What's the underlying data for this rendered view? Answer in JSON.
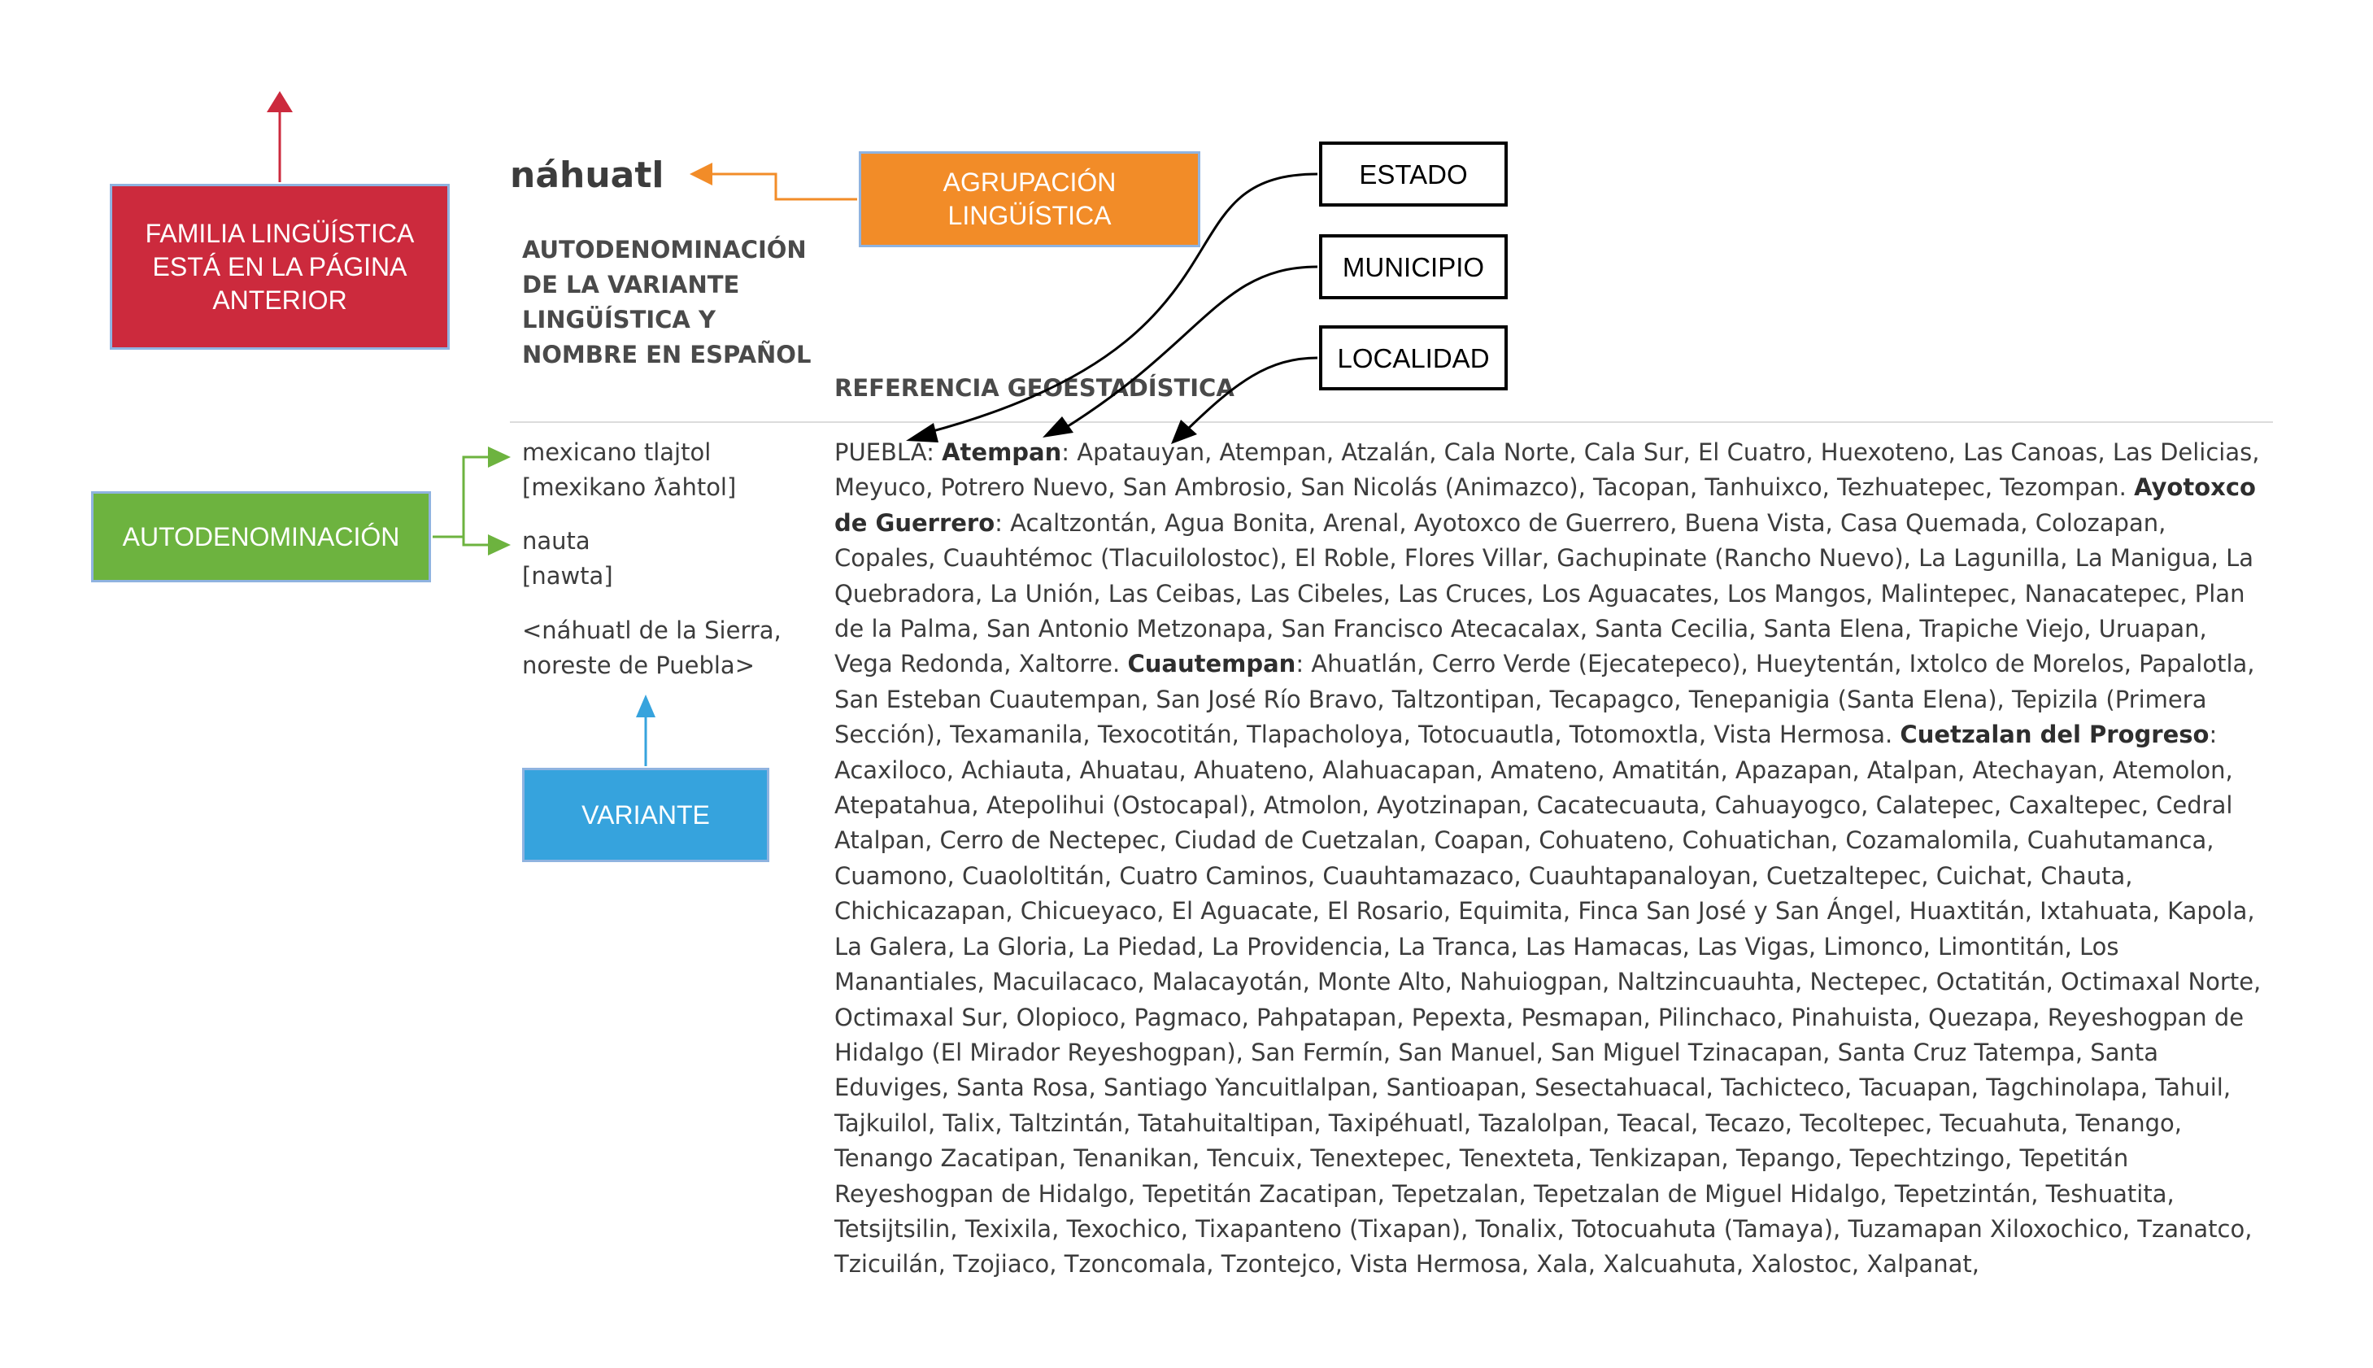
{
  "title": "náhuatl",
  "headers": {
    "left": "AUTODENOMINACIÓN DE LA VARIANTE LINGÜÍSTICA Y NOMBRE EN ESPAÑOL",
    "right": "REFERENCIA GEOESTADÍSTICA"
  },
  "variants": [
    {
      "name": "mexicano tlajtol",
      "ipa": "[mexikano ƛahtol]"
    },
    {
      "name": "nauta",
      "ipa": "[nawta]"
    }
  ],
  "spanish_name": "<náhuatl de la Sierra, noreste de Puebla>",
  "geo": [
    {
      "state": "PUEBLA",
      "municipality": "Atempan",
      "localities": "Apatauyan, Atempan, Atzalán, Cala Norte, Cala Sur, El Cuatro, Huexoteno, Las Canoas, Las Delicias, Meyuco, Potrero Nuevo, San Ambrosio, San Nicolás (Animazco), Tacopan, Tanhuixco, Tezhuatepec, Tezompan."
    },
    {
      "municipality": "Ayotoxco de Guerrero",
      "localities": "Acaltzontán, Agua Bonita, Arenal, Ayotoxco de Guerrero, Buena Vista, Casa Quemada, Colozapan, Copales, Cuauhtémoc (Tlacuilolostoc), El Roble, Flores Villar, Gachupinate (Rancho Nuevo), La Lagunilla, La Manigua, La Quebradora, La Unión, Las Ceibas, Las Cibeles, Las Cruces, Los Aguacates, Los Mangos, Malintepec, Nanacatepec, Plan de la Palma, San Antonio Metzonapa, San Francisco Atecacalax, Santa Cecilia, Santa Elena, Trapiche Viejo, Uruapan, Vega Redonda, Xaltorre."
    },
    {
      "municipality": "Cuautempan",
      "localities": "Ahuatlán, Cerro Verde (Ejecatepeco), Hueytentán, Ixtolco de Morelos, Papalotla, San Esteban Cuautempan, San José Río Bravo, Taltzontipan, Tecapagco, Tenepanigia (Santa Elena), Tepizila (Primera Sección), Texamanila, Texocotitán, Tlapacholoya, Totocuautla, Totomoxtla, Vista Hermosa."
    },
    {
      "municipality": "Cuetzalan del Progreso",
      "localities": "Acaxiloco, Achiauta, Ahuatau, Ahuateno, Alahuacapan, Amateno, Amatitán, Apazapan, Atalpan, Atechayan, Atemolon, Atepatahua, Atepolihui (Ostocapal), Atmolon, Ayotzinapan, Cacatecuauta, Cahuayogco, Calatepec, Caxaltepec, Cedral Atalpan, Cerro de Nectepec, Ciudad de Cuetzalan, Coapan, Cohuateno, Cohuatichan, Cozamalomila, Cuahutamanca, Cuamono, Cuaololtitán, Cuatro Caminos, Cuauhtamazaco, Cuauhtapanaloyan, Cuetzaltepec, Cuichat, Chauta, Chichicazapan, Chicueyaco, El Aguacate, El Rosario, Equimita, Finca San José y San Ángel, Huaxtitán, Ixtahuata, Kapola, La Galera, La Gloria, La Piedad, La Providencia, La Tranca, Las Hamacas, Las Vigas, Limonco, Limontitán, Los Manantiales, Macuilacaco, Malacayotán, Monte Alto, Nahuiogpan, Naltzincuauhta, Nectepec, Octatitán, Octimaxal Norte, Octimaxal Sur, Olopioco, Pagmaco, Pahpatapan, Pepexta, Pesmapan, Pilinchaco, Pinahuista, Quezapa, Reyeshogpan de Hidalgo (El Mirador Reyeshogpan), San Fermín, San Manuel, San Miguel Tzinacapan, Santa Cruz Tatempa, Santa Eduviges, Santa Rosa, Santiago Yancuitlalpan, Santioapan, Sesectahuacal, Tachicteco, Tacuapan, Tagchinolapa, Tahuil, Tajkuilol, Talix, Taltzintán, Tatahuitaltipan, Taxipéhuatl, Tazalolpan, Teacal, Tecazo, Tecoltepec, Tecuahuta, Tenango, Tenango Zacatipan, Tenanikan, Tencuix, Tenextepec, Tenexteta, Tenkizapan, Tepango, Tepechtzingo, Tepetitán Reyeshogpan de Hidalgo, Tepetitán Zacatipan, Tepetzalan, Tepetzalan de Miguel Hidalgo, Tepetzintán, Teshuatita, Tetsijtsilin, Texixila, Texochico, Tixapanteno (Tixapan), Tonalix, Totocuahuta (Tamaya), Tuzamapan Xiloxochico, Tzanatco, Tzicuilán, Tzojiaco, Tzoncomala, Tzontejco, Vista Hermosa, Xala, Xalcuahuta, Xalostoc, Xalpanat,"
    }
  ],
  "annotations": {
    "familia": "FAMILIA LINGÜÍSTICA ESTÁ EN LA PÁGINA ANTERIOR",
    "agrupacion": "AGRUPACIÓN LINGÜÍSTICA",
    "autodenominacion": "AUTODENOMINACIÓN",
    "variante": "VARIANTE",
    "estado": "ESTADO",
    "municipio": "MUNICIPIO",
    "localidad": "LOCALIDAD"
  },
  "colors": {
    "familia": "#cc2a3d",
    "agrupacion": "#f28c28",
    "autodenominacion": "#6db33f",
    "variante": "#36a3dd"
  }
}
